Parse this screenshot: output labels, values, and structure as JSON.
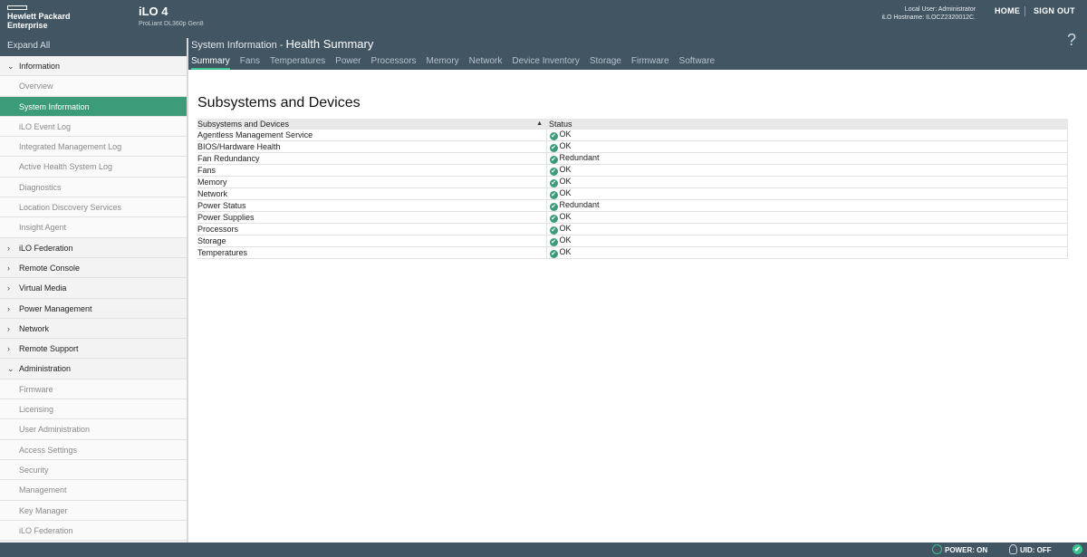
{
  "header": {
    "brand_line1": "Hewlett Packard",
    "brand_line2": "Enterprise",
    "product_name": "iLO 4",
    "product_model": "ProLiant DL360p Gen8",
    "user_line": "Local User: Administrator",
    "hostname_line": "iLO Hostname: ILOCZ2320012C.",
    "home_label": "HOME",
    "signout_label": "SIGN OUT"
  },
  "sidebar": {
    "expand_all": "Expand All",
    "groups": [
      {
        "label": "Information",
        "expanded": true,
        "items": [
          "Overview",
          "System Information",
          "iLO Event Log",
          "Integrated Management Log",
          "Active Health System Log",
          "Diagnostics",
          "Location Discovery Services",
          "Insight Agent"
        ]
      },
      {
        "label": "iLO Federation",
        "expanded": false
      },
      {
        "label": "Remote Console",
        "expanded": false
      },
      {
        "label": "Virtual Media",
        "expanded": false
      },
      {
        "label": "Power Management",
        "expanded": false
      },
      {
        "label": "Network",
        "expanded": false
      },
      {
        "label": "Remote Support",
        "expanded": false
      },
      {
        "label": "Administration",
        "expanded": true,
        "items": [
          "Firmware",
          "Licensing",
          "User Administration",
          "Access Settings",
          "Security",
          "Management",
          "Key Manager",
          "iLO Federation"
        ]
      }
    ],
    "active_item": "System Information"
  },
  "page": {
    "title_prefix": "System Information - ",
    "title": "Health Summary",
    "tabs": [
      "Summary",
      "Fans",
      "Temperatures",
      "Power",
      "Processors",
      "Memory",
      "Network",
      "Device Inventory",
      "Storage",
      "Firmware",
      "Software"
    ],
    "active_tab": "Summary"
  },
  "subsystems": {
    "title": "Subsystems and Devices",
    "col_name": "Subsystems and Devices",
    "col_status": "Status",
    "rows": [
      {
        "name": "Agentless Management Service",
        "status": "OK"
      },
      {
        "name": "BIOS/Hardware Health",
        "status": "OK"
      },
      {
        "name": "Fan Redundancy",
        "status": "Redundant"
      },
      {
        "name": "Fans",
        "status": "OK"
      },
      {
        "name": "Memory",
        "status": "OK"
      },
      {
        "name": "Network",
        "status": "OK"
      },
      {
        "name": "Power Status",
        "status": "Redundant"
      },
      {
        "name": "Power Supplies",
        "status": "OK"
      },
      {
        "name": "Processors",
        "status": "OK"
      },
      {
        "name": "Storage",
        "status": "OK"
      },
      {
        "name": "Temperatures",
        "status": "OK"
      }
    ]
  },
  "footer": {
    "power": "POWER: ON",
    "uid": "UID: OFF"
  },
  "colors": {
    "header": "#425563",
    "accent": "#3c9c7a",
    "status_ok": "#3cc28f"
  },
  "icons": {
    "help": "question-mark-icon",
    "status": "check-circle-icon",
    "power": "power-icon",
    "uid": "lightbulb-icon",
    "health": "check-circle-icon"
  }
}
